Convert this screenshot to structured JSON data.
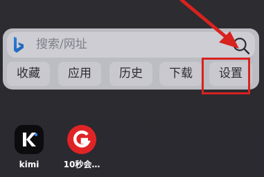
{
  "search": {
    "placeholder": "搜索/网址",
    "icons": {
      "left": "bing-logo-icon",
      "right": "search-icon"
    }
  },
  "quick_actions": [
    {
      "label": "收藏"
    },
    {
      "label": "应用"
    },
    {
      "label": "历史"
    },
    {
      "label": "下载"
    },
    {
      "label": "设置"
    }
  ],
  "annotation": {
    "highlight_color": "#d8221e",
    "target": "设置"
  },
  "apps": [
    {
      "label": "kimi",
      "icon": "kimi-app-icon"
    },
    {
      "label": "10秒会…",
      "icon": "10-seconds-app-icon",
      "color": "#e02425"
    }
  ]
}
